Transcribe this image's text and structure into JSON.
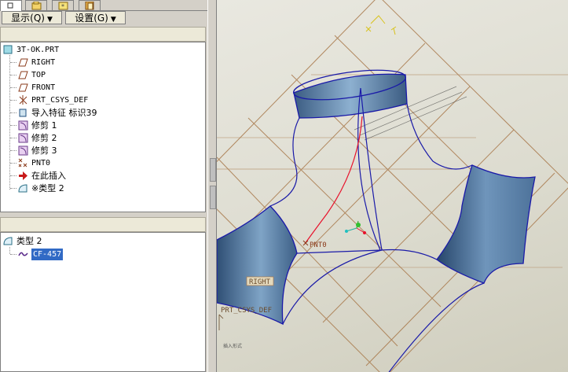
{
  "left_panel": {
    "tabs": [
      {
        "name": "model-tree-tab",
        "icon": "tree-icon"
      },
      {
        "name": "folder-tab",
        "icon": "folder-icon"
      },
      {
        "name": "favorites-tab",
        "icon": "favorites-icon"
      },
      {
        "name": "layers-tab",
        "icon": "layers-icon"
      }
    ],
    "show_menu_label": "显示",
    "show_menu_key": "(Q)",
    "settings_menu_label": "设置",
    "settings_menu_key": "(G)",
    "model_tree": {
      "root": "3T-OK.PRT",
      "items": [
        {
          "label": "RIGHT",
          "icon": "datum-plane-icon"
        },
        {
          "label": "TOP",
          "icon": "datum-plane-icon"
        },
        {
          "label": "FRONT",
          "icon": "datum-plane-icon"
        },
        {
          "label": "PRT_CSYS_DEF",
          "icon": "coordinate-system-icon"
        },
        {
          "label": "导入特征 标识39",
          "icon": "import-feature-icon"
        },
        {
          "label": "修剪 1",
          "icon": "trim-icon"
        },
        {
          "label": "修剪 2",
          "icon": "trim-icon"
        },
        {
          "label": "修剪 3",
          "icon": "trim-icon"
        },
        {
          "label": "PNT0",
          "icon": "datum-point-icon"
        },
        {
          "label": "在此插入",
          "icon": "insert-here-arrow-icon"
        },
        {
          "label": "※类型 2",
          "icon": "surface-type-icon"
        }
      ]
    },
    "detail_tree": {
      "root": "类型 2",
      "child": "CF-457"
    }
  },
  "viewport": {
    "labels": {
      "pnt0": "PNT0",
      "right": "RIGHT",
      "csys": "PRT_CSYS_DEF",
      "note": "插入形式"
    },
    "colors": {
      "background": "#dcdbcf",
      "datum_grid": "#a8784a",
      "surface": "#4d6f93",
      "edge": "#1a1aa8",
      "curve": "#e8102a",
      "tree_selection": "#316ac5"
    }
  }
}
